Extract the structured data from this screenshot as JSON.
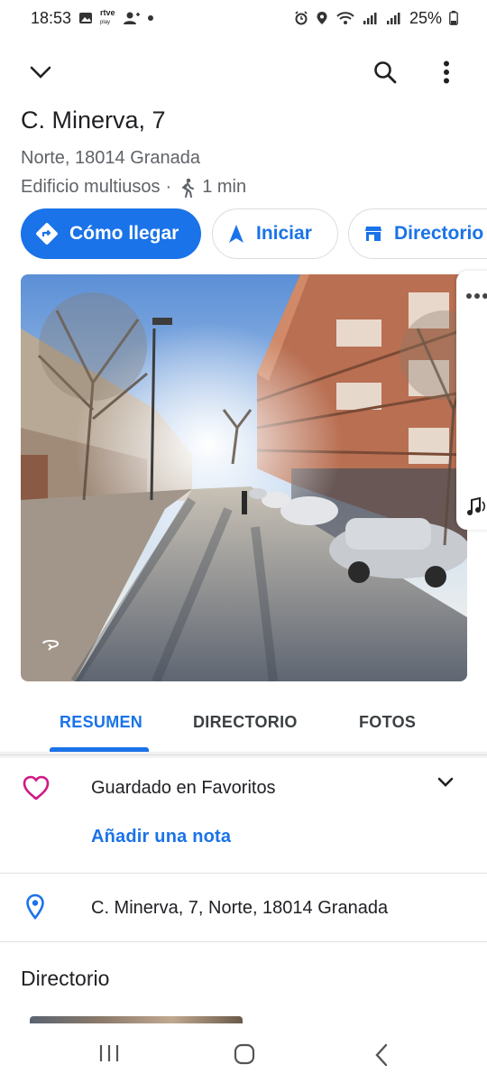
{
  "status_bar": {
    "time": "18:53",
    "rtve_label_top": "rtve",
    "rtve_label_bottom": "play",
    "battery": "25%"
  },
  "header": {
    "back_icon": "chevron-down-icon",
    "search_icon": "search-icon",
    "more_icon": "more-vert-icon"
  },
  "place": {
    "title": "C. Minerva, 7",
    "subtitle": "Norte, 18014 Granada",
    "category": "Edificio multiusos",
    "separator": "·",
    "walk_time": "1 min"
  },
  "actions": {
    "directions_label": "Cómo llegar",
    "start_label": "Iniciar",
    "directory_label": "Directorio"
  },
  "tabs": [
    {
      "label": "RESUMEN",
      "active": true
    },
    {
      "label": "DIRECTORIO",
      "active": false
    },
    {
      "label": "FOTOS",
      "active": false
    }
  ],
  "saved": {
    "label": "Guardado en Favoritos",
    "add_note": "Añadir una nota"
  },
  "address": {
    "text": "C. Minerva, 7, Norte, 18014 Granada"
  },
  "directory_section": {
    "heading": "Directorio"
  },
  "colors": {
    "accent": "#1a73e8",
    "heart": "#d01884",
    "text_secondary": "#5f6368"
  }
}
